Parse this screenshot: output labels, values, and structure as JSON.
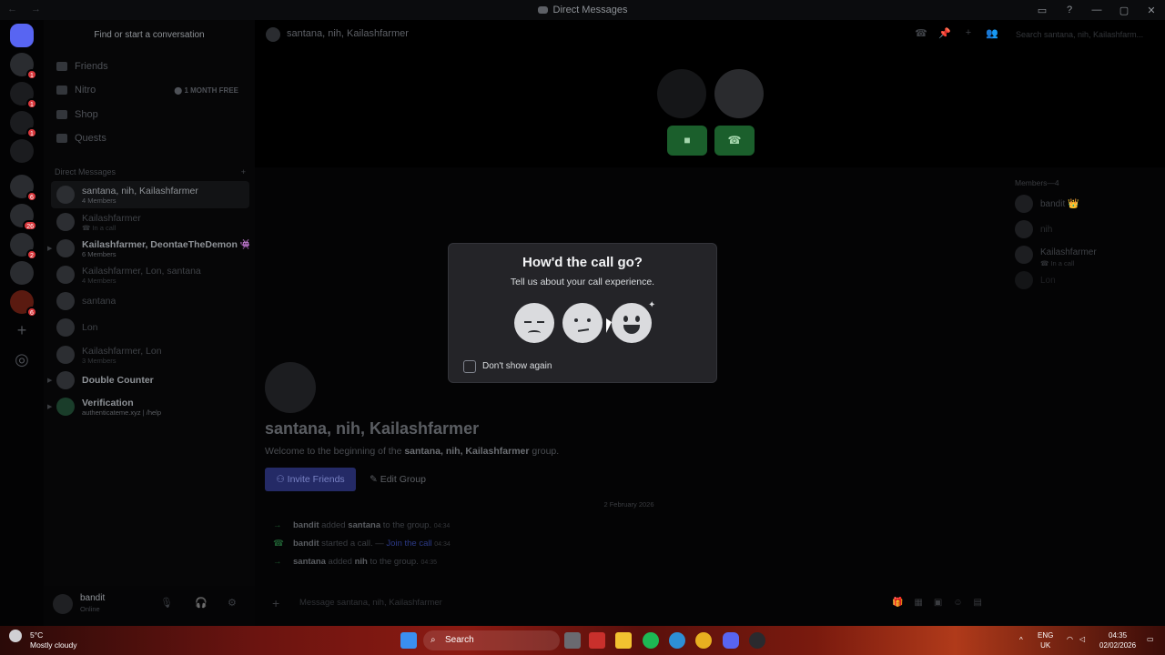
{
  "window": {
    "title": "Direct Messages",
    "nav_arrows": "← →",
    "controls": [
      "▭",
      "?",
      "—",
      "▢",
      "✕"
    ]
  },
  "servers": [
    {
      "name": "home",
      "badge": ""
    },
    {
      "name": "server-1",
      "badge": "1"
    },
    {
      "name": "server-2",
      "badge": "1"
    },
    {
      "name": "server-3",
      "badge": "1"
    },
    {
      "name": "server-4",
      "badge": ""
    },
    {
      "name": "server-5",
      "badge": "6"
    },
    {
      "name": "server-6",
      "badge": "26"
    },
    {
      "name": "server-7",
      "badge": "2"
    },
    {
      "name": "server-8",
      "badge": "6"
    },
    {
      "name": "server-9",
      "badge": ""
    }
  ],
  "sidebar": {
    "search_placeholder": "Find or start a conversation",
    "nav": [
      {
        "label": "Friends",
        "icon": "friends-icon"
      },
      {
        "label": "Nitro",
        "icon": "nitro-icon",
        "promo": "⬤ 1 MONTH FREE"
      },
      {
        "label": "Shop",
        "icon": "shop-icon"
      },
      {
        "label": "Quests",
        "icon": "quests-icon"
      }
    ],
    "dm_header": "Direct Messages",
    "dm_add": "+",
    "dms": [
      {
        "name": "santana, nih, Kailashfarmer",
        "sub": "4 Members"
      },
      {
        "name": "Kailashfarmer",
        "sub": "☎ In a call"
      },
      {
        "name": "Kailashfarmer, DeontaeTheDemon 👾 ...",
        "sub": "6 Members"
      },
      {
        "name": "Kailashfarmer, Lon, santana",
        "sub": "4 Members"
      },
      {
        "name": "santana",
        "sub": ""
      },
      {
        "name": "Lon",
        "sub": ""
      },
      {
        "name": "Kailashfarmer, Lon",
        "sub": "3 Members"
      },
      {
        "name": "Double Counter",
        "sub": ""
      },
      {
        "name": "Verification",
        "sub": "authenticateme.xyz | /help"
      }
    ]
  },
  "user": {
    "name": "bandit",
    "status": "Online"
  },
  "header": {
    "title": "santana, nih, Kailashfarmer",
    "search_placeholder": "Search santana, nih, Kailashfarm..."
  },
  "members": {
    "heading": "Members—4",
    "list": [
      {
        "name": "bandit 👑",
        "sub": ""
      },
      {
        "name": "nih",
        "sub": ""
      },
      {
        "name": "Kailashfarmer",
        "sub": "☎ In a call"
      },
      {
        "name": "Lon",
        "sub": ""
      }
    ]
  },
  "chat": {
    "group_title": "santana, nih, Kailashfarmer",
    "welcome_prefix": "Welcome to the beginning of the",
    "welcome_name": "santana, nih, Kailashfarmer",
    "welcome_suffix": "group.",
    "invite_label": "Invite Friends",
    "edit_label": "Edit Group",
    "date": "2 February 2026",
    "messages": [
      {
        "actor": "bandit",
        "text": "added",
        "target": "santana",
        "tail": "to the group.",
        "time": "04:34"
      },
      {
        "actor": "bandit",
        "text": "started a call. —",
        "link": "Join the call",
        "time": "04:34"
      },
      {
        "actor": "santana",
        "text": "added",
        "target": "nih",
        "tail": "to the group.",
        "time": "04:35"
      }
    ],
    "composer_placeholder": "Message santana, nih, Kailashfarmer"
  },
  "modal": {
    "title": "How'd the call go?",
    "subtitle": "Tell us about your call experience.",
    "options": [
      "sad-face-icon",
      "neutral-face-icon",
      "happy-face-icon"
    ],
    "checkbox_label": "Don't show again",
    "checkbox_checked": false
  },
  "taskbar": {
    "weather_temp": "5°C",
    "weather_desc": "Mostly cloudy",
    "search_label": "Search",
    "lang_top": "ENG",
    "lang_bottom": "UK",
    "time": "04:35",
    "date": "02/02/2026"
  },
  "colors": {
    "brand": "#5865f2",
    "call_green": "#1b5f2c",
    "modal_bg": "#242428"
  }
}
